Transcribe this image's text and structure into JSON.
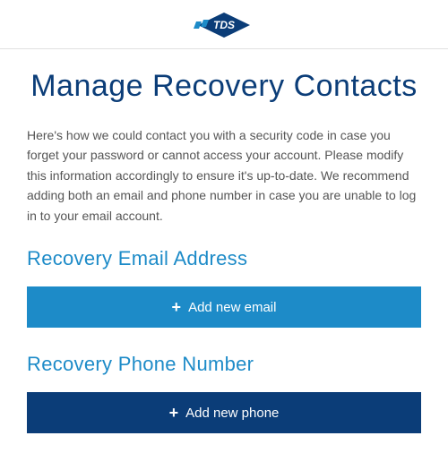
{
  "logo_text": "TDS",
  "title": "Manage Recovery Contacts",
  "description": "Here's how we could contact you with a security code in case you forget your password or cannot access your account. Please modify this information accordingly to ensure it's up-to-date. We recommend adding both an email and phone number in case you are unable to log in to your email account.",
  "sections": {
    "email": {
      "heading": "Recovery Email Address",
      "button_label": "Add new email"
    },
    "phone": {
      "heading": "Recovery Phone Number",
      "button_label": "Add new phone"
    }
  }
}
